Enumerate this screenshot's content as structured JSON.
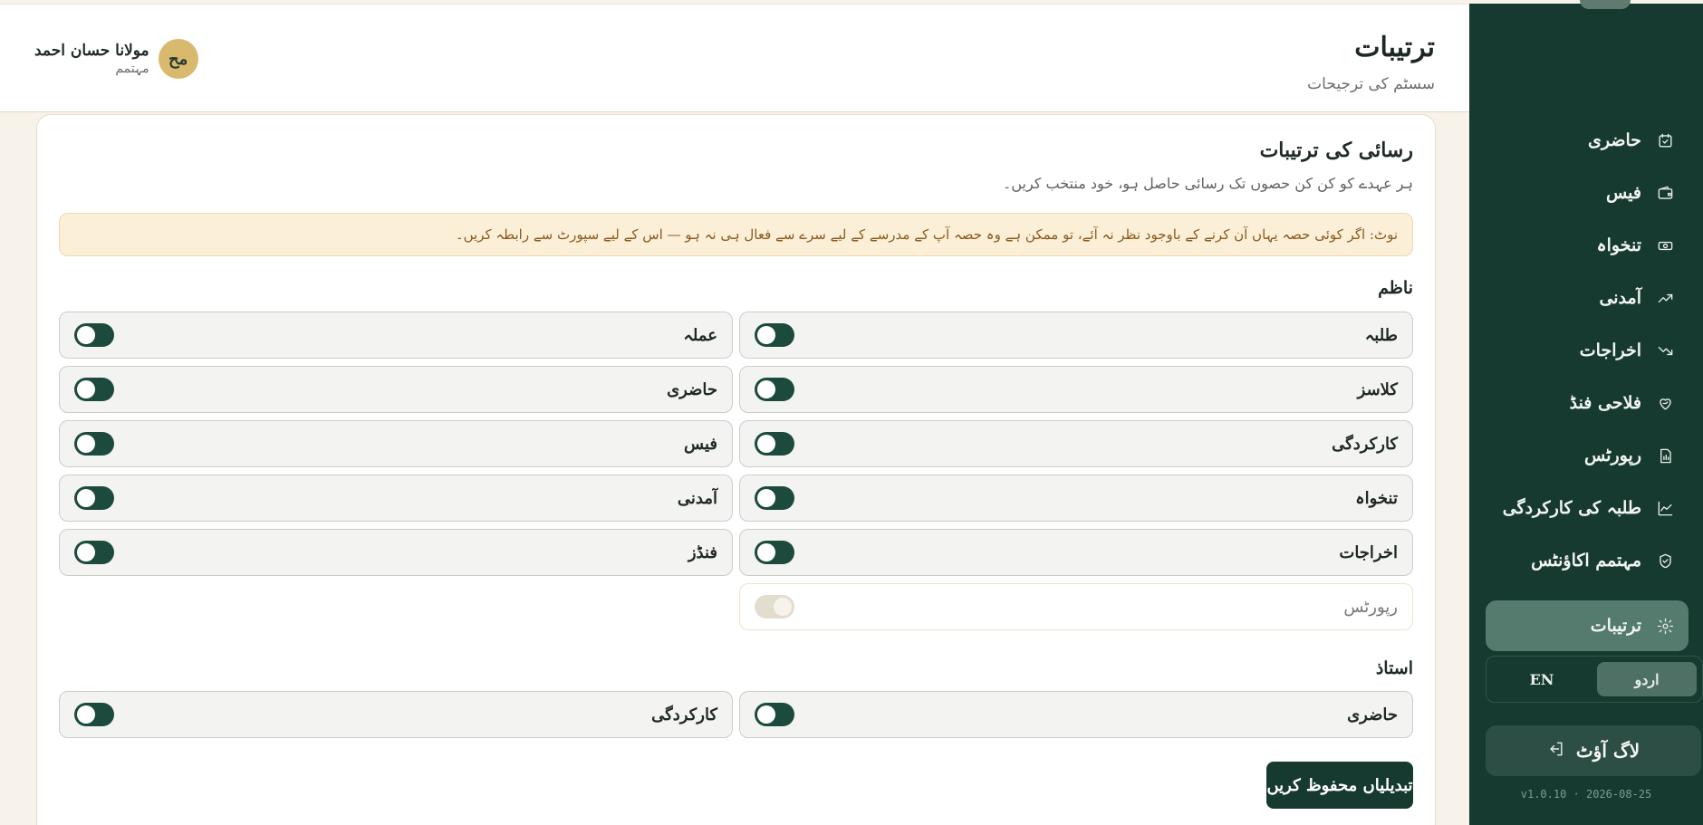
{
  "header": {
    "title": "ترتیبات",
    "subtitle": "سسٹم کی ترجیحات",
    "user": {
      "initials": "مح",
      "name": "مولانا حسان احمد",
      "role": "مہتمم"
    }
  },
  "sidebar": {
    "items": [
      {
        "label": "حاضری",
        "icon": "calendar-check-icon"
      },
      {
        "label": "فیس",
        "icon": "wallet-icon"
      },
      {
        "label": "تنخواہ",
        "icon": "banknote-icon"
      },
      {
        "label": "آمدنی",
        "icon": "trending-up-icon"
      },
      {
        "label": "اخراجات",
        "icon": "trending-down-icon"
      },
      {
        "label": "فلاحی فنڈ",
        "icon": "heart-hand-icon"
      },
      {
        "label": "رپورٹس",
        "icon": "file-chart-icon"
      },
      {
        "label": "طلبہ کی کارکردگی",
        "icon": "line-chart-icon"
      },
      {
        "label": "مہتمم اکاؤنٹس",
        "icon": "shield-check-icon"
      },
      {
        "label": "ترتیبات",
        "icon": "gear-icon",
        "active": true
      }
    ],
    "lang": {
      "urdu": "اردو",
      "english": "EN",
      "selected": "urdu"
    },
    "logout": "لاگ آؤٹ",
    "version": "v1.0.10 · 2026-08-25"
  },
  "card": {
    "title": "رسائی کی ترتیبات",
    "description": "ہر عہدے کو کن کن حصوں تک رسائی حاصل ہو، خود منتخب کریں۔",
    "note": "نوٹ: اگر کوئی حصہ یہاں آن کرنے کے باوجود نظر نہ آئے، تو ممکن ہے وہ حصہ آپ کے مدرسے کے لیے سرے سے فعال ہی نہ ہو — اس کے لیے سپورٹ سے رابطہ کریں۔",
    "sections": [
      {
        "label": "ناظم",
        "perms": [
          {
            "label": "طلبہ",
            "on": false
          },
          {
            "label": "عملہ",
            "on": false
          },
          {
            "label": "کلاسز",
            "on": false
          },
          {
            "label": "حاضری",
            "on": false
          },
          {
            "label": "کارکردگی",
            "on": false
          },
          {
            "label": "فیس",
            "on": false
          },
          {
            "label": "تنخواہ",
            "on": false
          },
          {
            "label": "آمدنی",
            "on": false
          },
          {
            "label": "اخراجات",
            "on": false
          },
          {
            "label": "فنڈز",
            "on": false
          },
          {
            "label": "رپورٹس",
            "on": true,
            "disabled": true
          }
        ]
      },
      {
        "label": "استاذ",
        "perms": [
          {
            "label": "حاضری",
            "on": false
          },
          {
            "label": "کارکردگی",
            "on": false
          }
        ]
      }
    ],
    "save_label": "تبدیلیاں محفوظ کریں"
  },
  "colors": {
    "sidebar_bg": "#173a30",
    "active_item": "#557a6e",
    "toggle_off": "#1c4a3c",
    "note_bg": "#fbefd8",
    "avatar": "#d8b96e"
  }
}
